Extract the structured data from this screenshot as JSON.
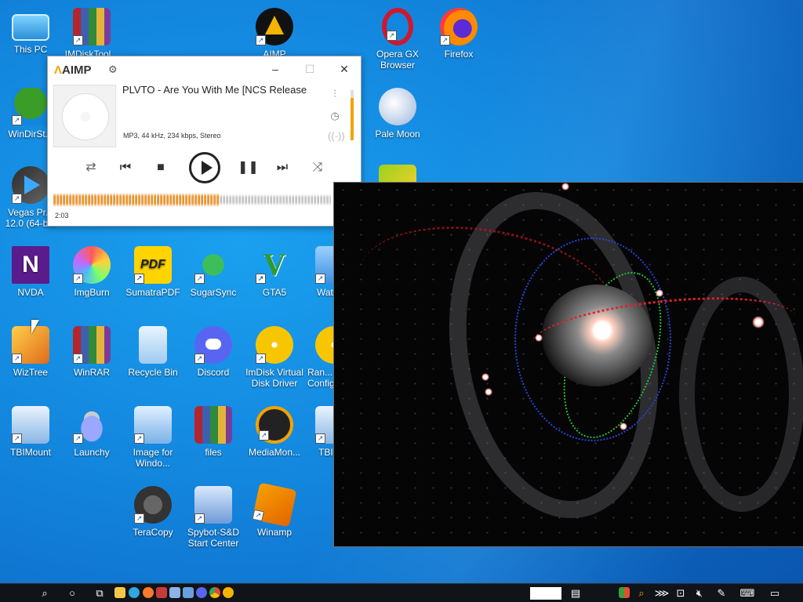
{
  "desktop": {
    "icons": [
      {
        "label": "This PC",
        "icon": "computer-icon"
      },
      {
        "label": "IMDiskTool...",
        "icon": "winrar-archive-icon"
      },
      {
        "label": "AIMP",
        "icon": "aimp-icon"
      },
      {
        "label": "Opera GX Browser",
        "icon": "opera-gx-icon"
      },
      {
        "label": "Firefox",
        "icon": "firefox-icon"
      },
      {
        "label": "WinDirSt...",
        "icon": "windirstat-icon"
      },
      {
        "label": "Pale Moon",
        "icon": "pale-moon-icon"
      },
      {
        "label": "Vegas Pr... 12.0 (64-b...",
        "icon": "vegas-icon"
      },
      {
        "label": "NVDA",
        "icon": "nvda-icon"
      },
      {
        "label": "ImgBurn",
        "icon": "imgburn-icon"
      },
      {
        "label": "SumatraPDF",
        "icon": "pdf-icon"
      },
      {
        "label": "SugarSync",
        "icon": "sugarsync-icon"
      },
      {
        "label": "GTA5",
        "icon": "gta-icon"
      },
      {
        "label": "Wat...",
        "icon": "app-icon"
      },
      {
        "label": "WizTree",
        "icon": "wiztree-icon"
      },
      {
        "label": "WinRAR",
        "icon": "winrar-icon"
      },
      {
        "label": "Recycle Bin",
        "icon": "recycle-bin-icon"
      },
      {
        "label": "Discord",
        "icon": "discord-icon"
      },
      {
        "label": "ImDisk Virtual Disk Driver",
        "icon": "disk-icon"
      },
      {
        "label": "Ran... Config...",
        "icon": "app-icon"
      },
      {
        "label": "TBIMount",
        "icon": "mount-icon"
      },
      {
        "label": "Launchy",
        "icon": "launchy-icon"
      },
      {
        "label": "Image for Windo...",
        "icon": "image-for-windows-icon"
      },
      {
        "label": "files",
        "icon": "winrar-archive-icon"
      },
      {
        "label": "MediaMon...",
        "icon": "mediamonkey-icon"
      },
      {
        "label": "TBI...",
        "icon": "app-icon"
      },
      {
        "label": "TeraCopy",
        "icon": "teracopy-icon"
      },
      {
        "label": "Spybot-S&D Start Center",
        "icon": "spybot-icon"
      },
      {
        "label": "Winamp",
        "icon": "winamp-icon"
      }
    ]
  },
  "player": {
    "app_name": "AIMP",
    "track_title": "PLVTO - Are You With Me [NCS Release",
    "track_info": "MP3, 44 kHz, 234 kbps, Stereo",
    "elapsed": "2:03",
    "progress_fraction": 0.6,
    "volume_fraction": 0.85,
    "colors": {
      "accent": "#f4a300",
      "waveform_played": "#e8953a",
      "waveform_rest": "#c8c8c8"
    }
  },
  "taskbar": {
    "pinned_icons": [
      "search-icon",
      "cortana-icon",
      "task-view-icon",
      "file-explorer-icon",
      "browser-icon",
      "firefox-icon",
      "app-icon",
      "app-icon",
      "app-icon",
      "discord-icon",
      "chrome-icon",
      "aimp-icon"
    ],
    "tray_icons": [
      "news-icon",
      "app-icon",
      "search-icon",
      "network-icon",
      "monitor-icon",
      "volume-muted-icon",
      "pen-icon",
      "keyboard-icon",
      "notifications-icon"
    ]
  }
}
